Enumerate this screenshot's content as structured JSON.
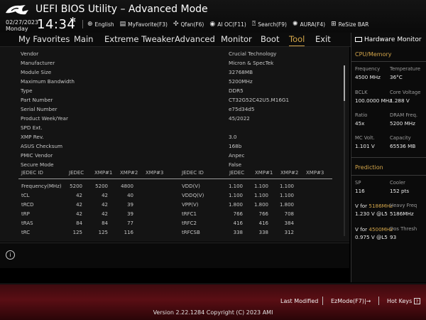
{
  "header": {
    "title": "UEFI BIOS Utility – Advanced Mode",
    "date": "02/27/2023",
    "day": "Monday",
    "time": "14:34",
    "toolbar": [
      {
        "icon": "globe-icon",
        "label": "English"
      },
      {
        "icon": "myfavorite-icon",
        "label": "MyFavorite(F3)"
      },
      {
        "icon": "fan-icon",
        "label": "Qfan(F6)"
      },
      {
        "icon": "ai-oc-icon",
        "label": "AI OC(F11)"
      },
      {
        "icon": "search-icon",
        "label": "Search(F9)"
      },
      {
        "icon": "aura-icon",
        "label": "AURA(F4)"
      },
      {
        "icon": "resize-bar-icon",
        "label": "ReSize BAR"
      }
    ]
  },
  "menu": {
    "tabs": [
      "My Favorites",
      "Main",
      "Extreme Tweaker",
      "Advanced",
      "Monitor",
      "Boot",
      "Tool",
      "Exit"
    ],
    "active": "Tool"
  },
  "spd": [
    {
      "label": "Vendor",
      "value": "Crucial Technology"
    },
    {
      "label": "Manufacturer",
      "value": "Micron & SpecTek"
    },
    {
      "label": "Module Size",
      "value": "32768MB"
    },
    {
      "label": "Maximum Bandwidth",
      "value": "5200MHz"
    },
    {
      "label": "Type",
      "value": "DDR5"
    },
    {
      "label": "Part Number",
      "value": "CT32G52C42U5.M16G1"
    },
    {
      "label": "Serial Number",
      "value": "e75d34d5"
    },
    {
      "label": "Product Week/Year",
      "value": "45/2022"
    },
    {
      "label": "SPD Ext.",
      "value": ""
    },
    {
      "label": "XMP Rev.",
      "value": "3.0"
    },
    {
      "label": "ASUS Checksum",
      "value": "168b"
    },
    {
      "label": "PMIC Vendor",
      "value": "Anpec"
    },
    {
      "label": "Secure Mode",
      "value": "False"
    }
  ],
  "timing_table": {
    "left_headers": [
      "JEDEC ID",
      "JEDEC",
      "XMP#1",
      "XMP#2",
      "XMP#3"
    ],
    "right_headers": [
      "JEDEC ID",
      "JEDEC",
      "XMP#1",
      "XMP#2",
      "XMP#3"
    ],
    "left_rows": [
      [
        "Frequency(MHz)",
        "5200",
        "5200",
        "4800",
        ""
      ],
      [
        "tCL",
        "42",
        "42",
        "40",
        ""
      ],
      [
        "tRCD",
        "42",
        "42",
        "39",
        ""
      ],
      [
        "tRP",
        "42",
        "42",
        "39",
        ""
      ],
      [
        "tRAS",
        "84",
        "84",
        "77",
        ""
      ],
      [
        "tRC",
        "125",
        "125",
        "116",
        ""
      ]
    ],
    "right_rows": [
      [
        "VDD(V)",
        "1.100",
        "1.100",
        "1.100",
        ""
      ],
      [
        "VDDQ(V)",
        "1.100",
        "1.100",
        "1.100",
        ""
      ],
      [
        "VPP(V)",
        "1.800",
        "1.800",
        "1.800",
        ""
      ],
      [
        "tRFC1",
        "766",
        "766",
        "708",
        ""
      ],
      [
        "tRFC2",
        "416",
        "416",
        "384",
        ""
      ],
      [
        "tRFCSB",
        "338",
        "338",
        "312",
        ""
      ]
    ]
  },
  "hardware_monitor": {
    "title": "Hardware Monitor",
    "cpu_section": "CPU/Memory",
    "cpu_items": [
      {
        "label": "Frequency",
        "value": "4500 MHz"
      },
      {
        "label": "Temperature",
        "value": "36°C"
      },
      {
        "label": "BCLK",
        "value": "100.0000 MHz"
      },
      {
        "label": "Core Voltage",
        "value": "1.288 V"
      },
      {
        "label": "Ratio",
        "value": "45x"
      },
      {
        "label": "DRAM Freq.",
        "value": "5200 MHz"
      },
      {
        "label": "MC Volt.",
        "value": "1.101 V"
      },
      {
        "label": "Capacity",
        "value": "65536 MB"
      }
    ],
    "prediction_section": "Prediction",
    "sp_label": "SP",
    "sp_value": "116",
    "cooler_label": "Cooler",
    "cooler_value": "152 pts",
    "v_for_prefix": "V for ",
    "v_for_freq1": "5186MHz",
    "v_for_value1": "1.230 V @L5",
    "heavy_freq_label": "Heavy Freq",
    "heavy_freq_value": "5186MHz",
    "v_for_freq2": "4500MHz",
    "v_for_value2": "0.975 V @L5",
    "dos_thresh_label": "Dos Thresh",
    "dos_thresh_value": "93"
  },
  "footer": {
    "last_modified": "Last Modified",
    "ezmode": "EzMode(F7)|→",
    "hot_keys": "Hot Keys",
    "hot_keys_icon": "?",
    "copyright": "Version 2.22.1284 Copyright (C) 2023 AMI"
  },
  "colors": {
    "accent": "#d4a64a",
    "footer_red": "#5a0e14",
    "background": "#141414"
  }
}
